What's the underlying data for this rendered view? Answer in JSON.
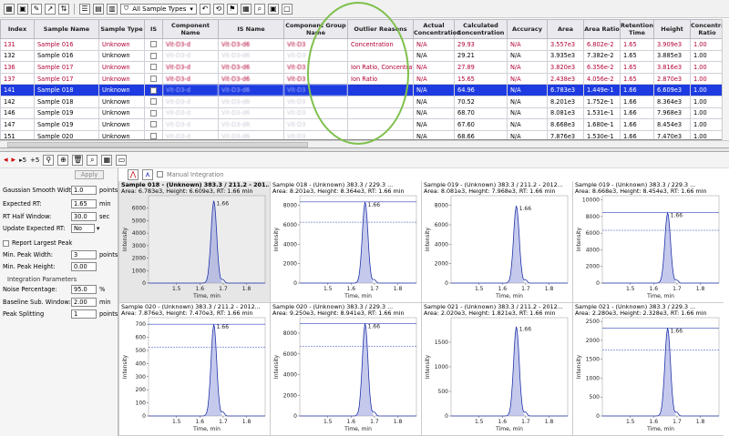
{
  "toolbar": {
    "filter_label": "All Sample Types"
  },
  "table": {
    "columns": [
      "Index",
      "Sample Name",
      "Sample Type",
      "IS",
      "Component Name",
      "IS Name",
      "Component Group Name",
      "Outlier Reasons",
      "Actual Concentration",
      "Calculated Concentration",
      "Accuracy",
      "Area",
      "Area Ratio",
      "Retention Time",
      "Height",
      "Concentration Ratio"
    ],
    "rows": [
      {
        "index": "131",
        "sample": "Sample 016",
        "type": "Unknown",
        "comp": "Vit-D3-d",
        "isname": "Vit-D3-d6",
        "group": "Vit-D3",
        "outlier": "Concentration",
        "actual": "N/A",
        "calc": "29.93",
        "acc": "N/A",
        "area": "3.557e3",
        "ratio": "6.802e-2",
        "rt": "1.65",
        "height": "3.909e3",
        "conc": "1.00",
        "style": "pink"
      },
      {
        "index": "132",
        "sample": "Sample 016",
        "type": "Unknown",
        "comp": "Vit-D3-d",
        "isname": "Vit-D3-d6",
        "group": "Vit-D3",
        "outlier": "",
        "actual": "N/A",
        "calc": "29.21",
        "acc": "N/A",
        "area": "3.935e3",
        "ratio": "7.382e-2",
        "rt": "1.65",
        "height": "3.885e3",
        "conc": "1.00",
        "style": ""
      },
      {
        "index": "136",
        "sample": "Sample 017",
        "type": "Unknown",
        "comp": "Vit-D3-d",
        "isname": "Vit-D3-d6",
        "group": "Vit-D3",
        "outlier": "Ion Ratio, Concentrat...",
        "actual": "N/A",
        "calc": "27.89",
        "acc": "N/A",
        "area": "3.820e3",
        "ratio": "6.356e-2",
        "rt": "1.65",
        "height": "3.816e3",
        "conc": "1.00",
        "style": "pink"
      },
      {
        "index": "137",
        "sample": "Sample 017",
        "type": "Unknown",
        "comp": "Vit-D3-d",
        "isname": "Vit-D3-d6",
        "group": "Vit-D3",
        "outlier": "Ion Ratio",
        "actual": "N/A",
        "calc": "15.65",
        "acc": "N/A",
        "area": "2.438e3",
        "ratio": "4.056e-2",
        "rt": "1.65",
        "height": "2.870e3",
        "conc": "1.00",
        "style": "pink"
      },
      {
        "index": "141",
        "sample": "Sample 018",
        "type": "Unknown",
        "comp": "Vit-D3-d",
        "isname": "Vit-D3-d6",
        "group": "Vit-D3",
        "outlier": "",
        "actual": "N/A",
        "calc": "64.96",
        "acc": "N/A",
        "area": "6.783e3",
        "ratio": "1.449e-1",
        "rt": "1.66",
        "height": "6.609e3",
        "conc": "1.00",
        "style": "sel"
      },
      {
        "index": "142",
        "sample": "Sample 018",
        "type": "Unknown",
        "comp": "Vit-D3-d",
        "isname": "Vit-D3-d6",
        "group": "Vit-D3",
        "outlier": "",
        "actual": "N/A",
        "calc": "70.52",
        "acc": "N/A",
        "area": "8.201e3",
        "ratio": "1.752e-1",
        "rt": "1.66",
        "height": "8.364e3",
        "conc": "1.00",
        "style": ""
      },
      {
        "index": "146",
        "sample": "Sample 019",
        "type": "Unknown",
        "comp": "Vit-D3-d",
        "isname": "Vit-D3-d6",
        "group": "Vit-D3",
        "outlier": "",
        "actual": "N/A",
        "calc": "68.70",
        "acc": "N/A",
        "area": "8.081e3",
        "ratio": "1.531e-1",
        "rt": "1.66",
        "height": "7.968e3",
        "conc": "1.00",
        "style": ""
      },
      {
        "index": "147",
        "sample": "Sample 019",
        "type": "Unknown",
        "comp": "Vit-D3-d",
        "isname": "Vit-D3-d6",
        "group": "Vit-D3",
        "outlier": "",
        "actual": "N/A",
        "calc": "67.60",
        "acc": "N/A",
        "area": "8.668e3",
        "ratio": "1.680e-1",
        "rt": "1.66",
        "height": "8.454e3",
        "conc": "1.00",
        "style": ""
      },
      {
        "index": "151",
        "sample": "Sample 020",
        "type": "Unknown",
        "comp": "Vit-D3-d",
        "isname": "Vit-D3-d6",
        "group": "Vit-D3",
        "outlier": "",
        "actual": "N/A",
        "calc": "68.66",
        "acc": "N/A",
        "area": "7.876e3",
        "ratio": "1.530e-1",
        "rt": "1.66",
        "height": "7.470e3",
        "conc": "1.00",
        "style": ""
      }
    ]
  },
  "review_toolbar": {
    "prev_label": "◂",
    "next_label": "▸",
    "step_back": "▸5",
    "step_fwd": "+5"
  },
  "params": {
    "apply_label": "Apply",
    "manual_integration_label": "Manual Integration",
    "fields": [
      {
        "label": "Gaussian Smooth Width:",
        "value": "1.0",
        "unit": "points"
      },
      {
        "label": "Expected RT:",
        "value": "1.65",
        "unit": "min"
      },
      {
        "label": "RT Half Window:",
        "value": "30.0",
        "unit": "sec"
      },
      {
        "label": "Update Expected RT:",
        "value": "No",
        "unit": ""
      },
      {
        "label": "Report Largest Peak",
        "value": "",
        "unit": ""
      },
      {
        "label": "Min. Peak Width:",
        "value": "3",
        "unit": "points"
      },
      {
        "label": "Min. Peak Height:",
        "value": "0.00",
        "unit": ""
      },
      {
        "label": "Integration Parameters",
        "value": "",
        "unit": ""
      },
      {
        "label": "Noise Percentage:",
        "value": "95.0",
        "unit": "%"
      },
      {
        "label": "Baseline Sub. Window:",
        "value": "2.00",
        "unit": "min"
      },
      {
        "label": "Peak Splitting",
        "value": "1",
        "unit": "points"
      }
    ]
  },
  "chart_data": [
    {
      "type": "line",
      "title": "Sample 018 - (Unknown) 383.3 / 211.2 - 201...",
      "subtitle": "Area: 6.783e3, Height: 6.609e3, RT: 1.66 min",
      "xlabel": "Time, min",
      "ylabel": "Intensity",
      "xlim": [
        1.38,
        1.88
      ],
      "ylim": [
        0,
        7000
      ],
      "yticks": [
        0,
        1000,
        2000,
        3000,
        4000,
        5000,
        6000
      ],
      "xticks": [
        1.5,
        1.6,
        1.7,
        1.8
      ],
      "peak_rt": 1.66,
      "peak_height": 6609,
      "peak_label": "1.66"
    },
    {
      "type": "line",
      "title": "Sample 018 - (Unknown) 383.3 / 229.3 ...",
      "subtitle": "Area: 8.201e3, Height: 8.364e3, RT: 1.66 min",
      "xlabel": "Time, min",
      "ylabel": "Intensity",
      "xlim": [
        1.38,
        1.88
      ],
      "ylim": [
        0,
        9000
      ],
      "yticks": [
        0,
        2000,
        4000,
        6000,
        8000
      ],
      "xticks": [
        1.5,
        1.6,
        1.7,
        1.8
      ],
      "peak_rt": 1.66,
      "peak_height": 8364,
      "peak_label": "1.66"
    },
    {
      "type": "line",
      "title": "Sample 019 - (Unknown) 383.3 / 211.2 - 2012...",
      "subtitle": "Area: 8.081e3, Height: 7.968e3, RT: 1.66 min",
      "xlabel": "Time, min",
      "ylabel": "Intensity",
      "xlim": [
        1.38,
        1.88
      ],
      "ylim": [
        0,
        9000
      ],
      "yticks": [
        0,
        2000,
        4000,
        6000,
        8000
      ],
      "xticks": [
        1.5,
        1.6,
        1.7,
        1.8
      ],
      "peak_rt": 1.66,
      "peak_height": 7968,
      "peak_label": "1.66"
    },
    {
      "type": "line",
      "title": "Sample 019 - (Unknown) 383.3 / 229.3 ...",
      "subtitle": "Area: 8.668e3, Height: 8.454e3, RT: 1.66 min",
      "xlabel": "Time, min",
      "ylabel": "Intensity",
      "xlim": [
        1.38,
        1.88
      ],
      "ylim": [
        0,
        10500
      ],
      "yticks": [
        0,
        2000,
        4000,
        6000,
        8000,
        10000
      ],
      "xticks": [
        1.5,
        1.6,
        1.7,
        1.8
      ],
      "peak_rt": 1.66,
      "peak_height": 8454,
      "peak_label": "1.66"
    },
    {
      "type": "line",
      "title": "Sample 020 - (Unknown) 383.3 / 211.2 - 2012...",
      "subtitle": "Area: 7.876e3, Height: 7.470e3, RT: 1.66 min",
      "xlabel": "Time, min",
      "ylabel": "Intensity",
      "xlim": [
        1.38,
        1.88
      ],
      "ylim": [
        0,
        750
      ],
      "yticks": [
        0,
        100,
        200,
        300,
        400,
        500,
        600,
        700
      ],
      "xticks": [
        1.5,
        1.6,
        1.7,
        1.8
      ],
      "peak_rt": 1.66,
      "peak_height": 700,
      "peak_label": "1.66"
    },
    {
      "type": "line",
      "title": "Sample 020 - (Unknown) 383.3 / 229.3 ...",
      "subtitle": "Area: 9.250e3, Height: 8.941e3, RT: 1.66 min",
      "xlabel": "Time, min",
      "ylabel": "Intensity",
      "xlim": [
        1.38,
        1.88
      ],
      "ylim": [
        0,
        9500
      ],
      "yticks": [
        0,
        2000,
        4000,
        6000,
        8000
      ],
      "xticks": [
        1.5,
        1.6,
        1.7,
        1.8
      ],
      "peak_rt": 1.66,
      "peak_height": 8941,
      "peak_label": "1.66"
    },
    {
      "type": "line",
      "title": "Sample 021 - (Unknown) 383.3 / 211.2 - 2012...",
      "subtitle": "Area: 2.020e3, Height: 1.821e3, RT: 1.66 min",
      "xlabel": "Time, min",
      "ylabel": "Intensity",
      "xlim": [
        1.38,
        1.88
      ],
      "ylim": [
        0,
        2000
      ],
      "yticks": [
        0,
        500,
        1000,
        1500
      ],
      "xticks": [
        1.5,
        1.6,
        1.7,
        1.8
      ],
      "peak_rt": 1.66,
      "peak_height": 1821,
      "peak_label": "1.66"
    },
    {
      "type": "line",
      "title": "Sample 021 - (Unknown) 383.3 / 229.3 ...",
      "subtitle": "Area: 2.280e3, Height: 2.328e3, RT: 1.66 min",
      "xlabel": "Time, min",
      "ylabel": "Intensity",
      "xlim": [
        1.38,
        1.88
      ],
      "ylim": [
        0,
        2600
      ],
      "yticks": [
        0,
        500,
        1000,
        1500,
        2000,
        2500
      ],
      "xticks": [
        1.5,
        1.6,
        1.7,
        1.8
      ],
      "peak_rt": 1.66,
      "peak_height": 2328,
      "peak_label": "1.66"
    }
  ],
  "colors": {
    "selected_row": "#1d3be0",
    "outlier_text": "#b20035",
    "trace": "#2233aa",
    "highlight_circle": "#7fc04c"
  }
}
